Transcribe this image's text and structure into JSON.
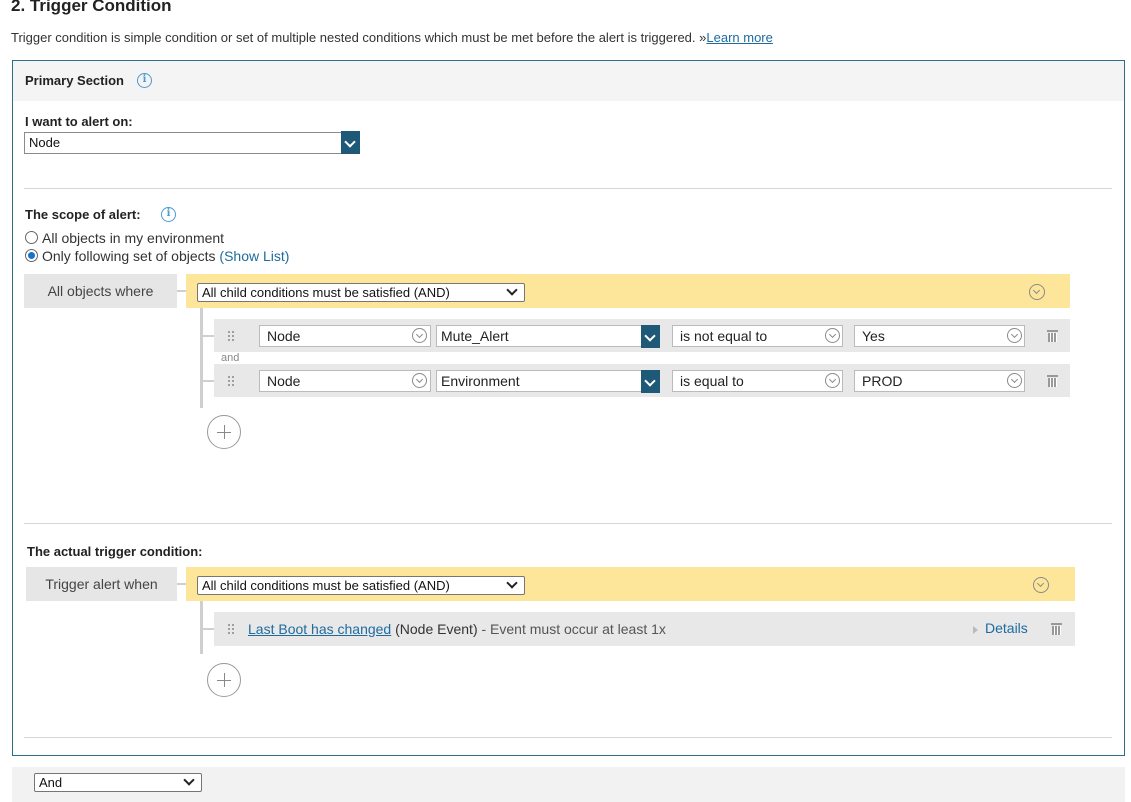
{
  "section": {
    "title": "2. Trigger Condition",
    "description": "Trigger condition is simple condition or set of multiple nested conditions which must be met before the alert is triggered. »",
    "learn_more": "Learn more"
  },
  "primary": {
    "title": "Primary Section"
  },
  "alert_on": {
    "label": "I want to alert on:",
    "value": "Node"
  },
  "scope": {
    "label": "The scope of alert:",
    "options": [
      {
        "label": "All objects in my environment",
        "selected": false
      },
      {
        "label": "Only following set of objects",
        "selected": true
      }
    ],
    "show_list": "(Show List)",
    "group_label": "All objects where",
    "group_select": "All child conditions must be satisfied (AND)",
    "conditions": [
      {
        "object": "Node",
        "field": "Mute_Alert",
        "operator": "is not equal to",
        "value": "Yes"
      },
      {
        "object": "Node",
        "field": "Environment",
        "operator": "is equal to",
        "value": "PROD"
      }
    ],
    "joiner": "and"
  },
  "trigger": {
    "label": "The actual trigger condition:",
    "group_label": "Trigger alert when",
    "group_select": "All child conditions must be satisfied (AND)",
    "event": {
      "link": "Last Boot has changed",
      "type": " (Node Event)",
      "suffix": " - Event must occur at least 1x",
      "details": "Details"
    }
  },
  "footer": {
    "and_select": "And"
  },
  "colors": {
    "accent": "#1e5a78",
    "link": "#1e6ba0",
    "group_bar": "#fde699",
    "panel_border": "#2e6c8a"
  }
}
